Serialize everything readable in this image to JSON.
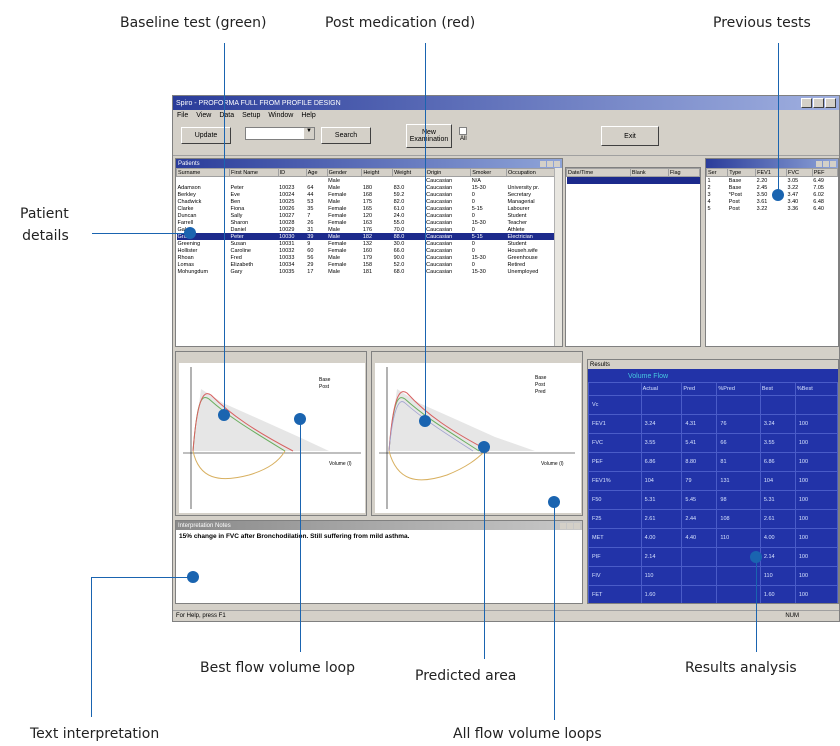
{
  "callouts": {
    "baseline": "Baseline test (green)",
    "post_med": "Post medication (red)",
    "previous": "Previous tests",
    "patient": "Patient\ndetails",
    "best_loop": "Best flow volume loop",
    "predicted": "Predicted area",
    "results": "Results analysis",
    "text_interp": "Text interpretation",
    "all_loops": "All flow volume loops"
  },
  "app": {
    "title": "Spiro - PROFORMA FULL FROM PROFILE DESIGN",
    "menu": [
      "File",
      "View",
      "Data",
      "Setup",
      "Window",
      "Help"
    ],
    "toolbar": {
      "update": "Update",
      "search": "Search",
      "new_examination": "New\nExamination",
      "exit": "Exit",
      "checkbox_label": "All"
    },
    "status": "For Help, press F1",
    "status_right": "NUM"
  },
  "patients": {
    "title": "Patients",
    "columns": [
      "Surname",
      "First Name",
      "ID",
      "Age",
      "Gender",
      "Height",
      "Weight",
      "Origin",
      "Smoker",
      "Occupation"
    ],
    "rows": [
      [
        "",
        "",
        "",
        "",
        "Male",
        "",
        "",
        "Caucasian",
        "N/A",
        ""
      ],
      [
        "Adamson",
        "Peter",
        "10023",
        "64",
        "Male",
        "180",
        "83.0",
        "Caucasian",
        "15-30",
        "University pr."
      ],
      [
        "Berkley",
        "Eve",
        "10024",
        "44",
        "Female",
        "168",
        "59.2",
        "Caucasian",
        "0",
        "Secretary"
      ],
      [
        "Chadwick",
        "Ben",
        "10025",
        "53",
        "Male",
        "175",
        "82.0",
        "Caucasian",
        "0",
        "Managerial"
      ],
      [
        "Clarke",
        "Fiona",
        "10026",
        "35",
        "Female",
        "165",
        "61.0",
        "Caucasian",
        "5-15",
        "Labourer"
      ],
      [
        "Duncan",
        "Sally",
        "10027",
        "7",
        "Female",
        "120",
        "24.0",
        "Caucasian",
        "0",
        "Student"
      ],
      [
        "Farrell",
        "Sharon",
        "10028",
        "26",
        "Female",
        "163",
        "55.0",
        "Caucasian",
        "15-30",
        "Teacher"
      ],
      [
        "Gale",
        "Daniel",
        "10029",
        "31",
        "Male",
        "176",
        "70.0",
        "Caucasian",
        "0",
        "Athlete"
      ],
      [
        "Grant",
        "Peter",
        "10030",
        "39",
        "Male",
        "182",
        "88.0",
        "Caucasian",
        "5-15",
        "Electrician"
      ],
      [
        "Greening",
        "Susan",
        "10031",
        "9",
        "Female",
        "132",
        "30.0",
        "Caucasian",
        "0",
        "Student"
      ],
      [
        "Hollister",
        "Caroline",
        "10032",
        "60",
        "Female",
        "160",
        "66.0",
        "Caucasian",
        "0",
        "Househ.wife"
      ],
      [
        "Rhoan",
        "Fred",
        "10033",
        "56",
        "Male",
        "179",
        "90.0",
        "Caucasian",
        "15-30",
        "Greenhouse"
      ],
      [
        "Lomas",
        "Elizabeth",
        "10034",
        "29",
        "Female",
        "158",
        "52.0",
        "Caucasian",
        "0",
        "Retired"
      ],
      [
        "Mohungdum",
        "Gary",
        "10035",
        "17",
        "Male",
        "181",
        "68.0",
        "Caucasian",
        "15-30",
        "Unemployed"
      ]
    ],
    "selected_row": 8
  },
  "test_list": {
    "columns": [
      "Date/Time",
      "Blank",
      "Flag"
    ],
    "rows": [
      [
        "",
        "",
        ""
      ]
    ]
  },
  "prev_tests": {
    "columns": [
      "Ser",
      "Type",
      "FEV1",
      "FVC",
      "PEF"
    ],
    "rows": [
      [
        "1",
        "Base",
        "2.20",
        "3.05",
        "6.49"
      ],
      [
        "2",
        "Base",
        "2.45",
        "3.22",
        "7.05"
      ],
      [
        "3",
        "*Post",
        "3.50",
        "3.47",
        "6.02"
      ],
      [
        "4",
        "Post",
        "3.61",
        "3.40",
        "6.48"
      ],
      [
        "5",
        "Post",
        "3.22",
        "3.36",
        "6.40"
      ]
    ]
  },
  "chart_left": {
    "legend": [
      "Base",
      "Post"
    ],
    "xlabel": "Volume (l)"
  },
  "chart_right": {
    "legend": [
      "Base",
      "Post",
      "Pred"
    ],
    "xlabel": "Volume (l)"
  },
  "interpretation": {
    "title": "Interpretation Notes",
    "text": "15% change in FVC after Bronchodilation. Still suffering from mild asthma."
  },
  "results": {
    "title": "Results",
    "heading": "Volume Flow",
    "columns": [
      "",
      "Actual",
      "Pred",
      "%Pred",
      "Best",
      "%Best"
    ],
    "rows": [
      [
        "Vc",
        "",
        "",
        "",
        "",
        ""
      ],
      [
        "FEV1",
        "3.24",
        "4.31",
        "76",
        "3.24",
        "100"
      ],
      [
        "FVC",
        "3.55",
        "5.41",
        "66",
        "3.55",
        "100"
      ],
      [
        "PEF",
        "6.86",
        "8.80",
        "81",
        "6.86",
        "100"
      ],
      [
        "FEV1%",
        "104",
        "79",
        "131",
        "104",
        "100"
      ],
      [
        "F50",
        "5.31",
        "5.45",
        "98",
        "5.31",
        "100"
      ],
      [
        "F25",
        "2.61",
        "2.44",
        "108",
        "2.61",
        "100"
      ],
      [
        "MET",
        "4.00",
        "4.40",
        "110",
        "4.00",
        "100"
      ],
      [
        "PIF",
        "2.14",
        "",
        "",
        "2.14",
        "100"
      ],
      [
        "FIV",
        "110",
        "",
        "",
        "110",
        "100"
      ],
      [
        "FET",
        "1.60",
        "",
        "",
        "1.60",
        "100"
      ]
    ]
  }
}
